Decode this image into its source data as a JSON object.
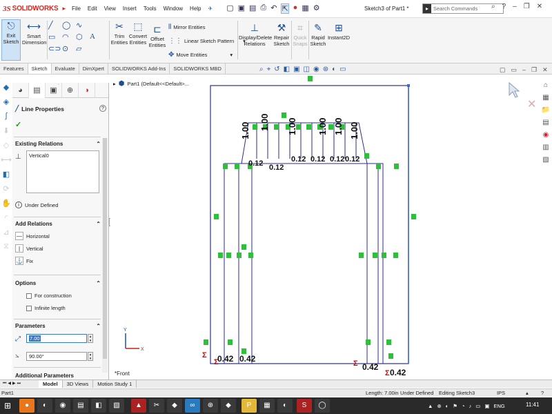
{
  "app": {
    "brand": "SOLIDWORKS",
    "brand_prefix": "3S",
    "document_title": "Sketch3 of Part1 *",
    "search_placeholder": "Search Commands"
  },
  "menu": [
    "File",
    "Edit",
    "View",
    "Insert",
    "Tools",
    "Window",
    "Help"
  ],
  "ribbon": {
    "exit_sketch": "Exit Sketch",
    "smart_dimension": "Smart Dimension",
    "trim_entities": "Trim Entities",
    "convert_entities": "Convert Entities",
    "offset_entities": "Offset Entities",
    "mirror_entities": "Mirror Entities",
    "linear_sketch_pattern": "Linear Sketch Pattern",
    "move_entities": "Move Entities",
    "display_delete_relations": "Display/Delete Relations",
    "repair_sketch": "Repair Sketch",
    "quick_snaps": "Quick Snaps",
    "rapid_sketch": "Rapid Sketch",
    "instant2d": "Instant2D"
  },
  "tabs": [
    "Features",
    "Sketch",
    "Evaluate",
    "DimXpert",
    "SOLIDWORKS Add-Ins",
    "SOLIDWORKS MBD"
  ],
  "active_tab": "Sketch",
  "property_manager": {
    "title": "Line Properties",
    "existing_relations_header": "Existing Relations",
    "existing_relations": [
      "Vertical0"
    ],
    "status": "Under Defined",
    "add_relations_header": "Add Relations",
    "add_relations": [
      "Horizontal",
      "Vertical",
      "Fix"
    ],
    "options_header": "Options",
    "options": [
      "For construction",
      "Infinite length"
    ],
    "parameters_header": "Parameters",
    "length_value": "7.00",
    "angle_value": "90.00°",
    "additional_parameters_header": "Additional Parameters"
  },
  "tree": {
    "part_label": "Part1  (Default<<Default>..."
  },
  "view_label": "*Front",
  "canvas_dims": {
    "d1": "1.00",
    "d2": "0.12",
    "d3": "0.42",
    "d4": "0.42",
    "d5": "0.42",
    "d6": "0.42"
  },
  "bottom_tabs": [
    "Model",
    "3D Views",
    "Motion Study 1"
  ],
  "active_bottom_tab": "Model",
  "status_bar": {
    "doc": "Part1",
    "length": "Length: 7.00in",
    "defined": "Under Defined",
    "editing": "Editing Sketch3",
    "units": "IPS"
  },
  "taskbar": {
    "lang": "ENG",
    "time": "11:41"
  }
}
